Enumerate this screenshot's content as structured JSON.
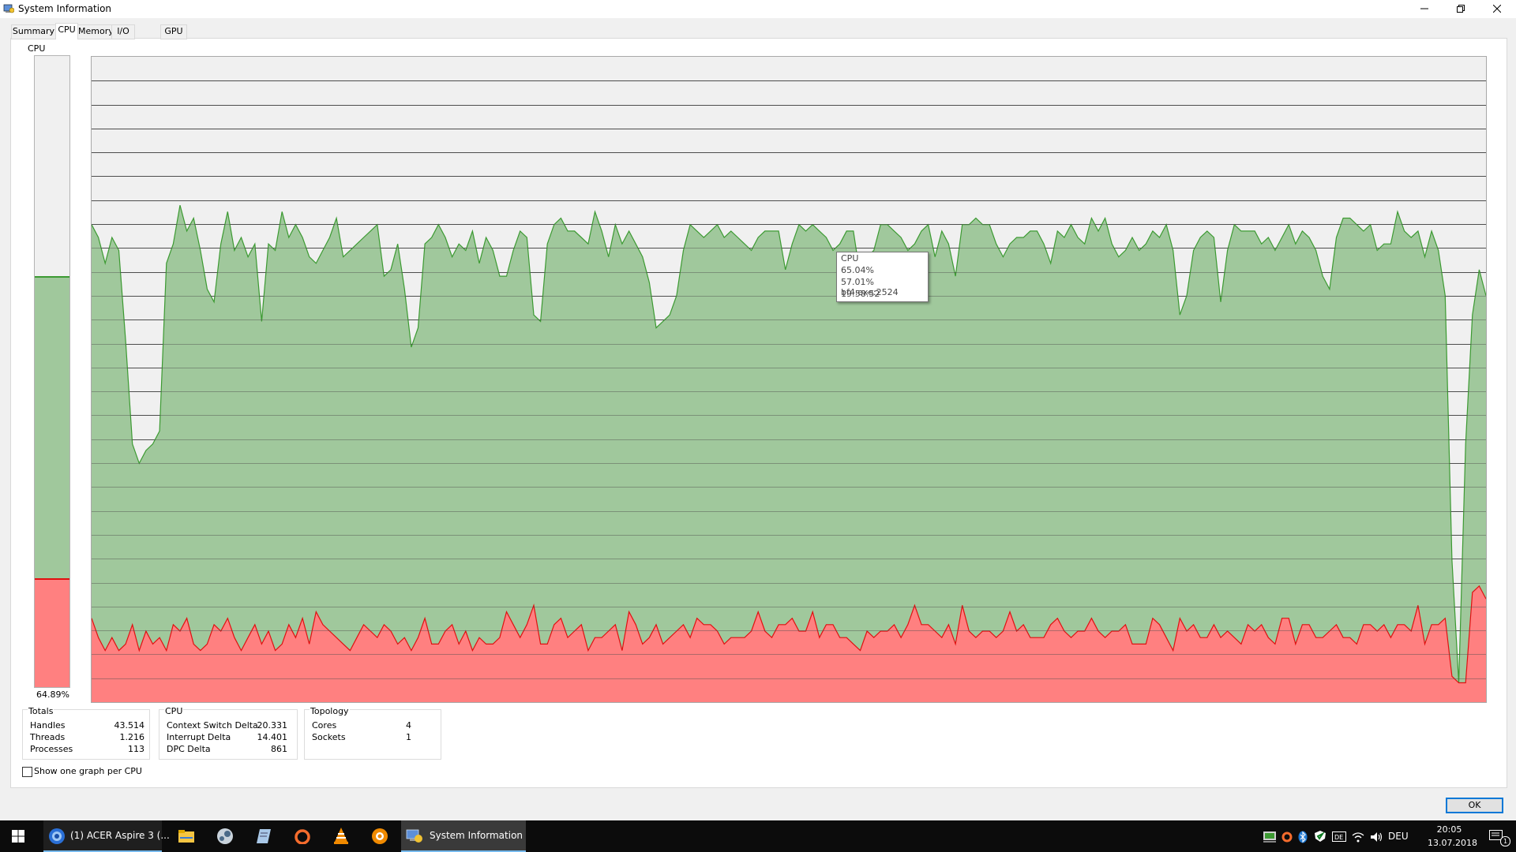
{
  "window": {
    "title": "System Information",
    "minimize_icon": "minimize-icon",
    "maximize_icon": "restore-icon",
    "close_icon": "close-icon"
  },
  "tabs": [
    {
      "label": "Summary",
      "active": false
    },
    {
      "label": "CPU",
      "active": true
    },
    {
      "label": "Memory",
      "active": false
    },
    {
      "label": "I/O",
      "active": false
    },
    {
      "label": "GPU",
      "active": false
    }
  ],
  "cpu_bar": {
    "label": "CPU",
    "percent_text": "64.89%",
    "total_fraction": 0.6489,
    "kernel_fraction": 0.17
  },
  "graph": {
    "colors": {
      "total": "#a0c89c",
      "total_line": "#3c9a32",
      "kernel": "#ff8080",
      "kernel_line": "#e01010",
      "background": "#f0f0f0",
      "grid": "#4d4d4d"
    },
    "tooltip": {
      "line1": "CPU",
      "line2": "65.04%",
      "line3": "57.01% bf4.exe:2524",
      "line4": "19:58:52"
    }
  },
  "chart_data": {
    "type": "area",
    "ylim": [
      0,
      100
    ],
    "grid": true,
    "series": [
      {
        "name": "Total CPU",
        "values": [
          74,
          72,
          68,
          72,
          70,
          56,
          40,
          37,
          39,
          40,
          42,
          68,
          71,
          77,
          73,
          75,
          70,
          64,
          62,
          71,
          76,
          70,
          72,
          69,
          71,
          59,
          71,
          70,
          76,
          72,
          74,
          72,
          69,
          68,
          70,
          72,
          75,
          69,
          70,
          71,
          72,
          73,
          74,
          66,
          67,
          71,
          64,
          55,
          58,
          71,
          72,
          74,
          72,
          69,
          71,
          70,
          73,
          68,
          72,
          70,
          66,
          66,
          70,
          73,
          72,
          60,
          59,
          71,
          74,
          75,
          73,
          73,
          72,
          71,
          76,
          73,
          69,
          74,
          71,
          73,
          71,
          69,
          65,
          58,
          59,
          60,
          63,
          70,
          74,
          73,
          72,
          73,
          74,
          72,
          73,
          72,
          71,
          70,
          72,
          73,
          73,
          73,
          67,
          71,
          74,
          73,
          74,
          73,
          72,
          70,
          71,
          73,
          73,
          66,
          69,
          70,
          74,
          74,
          73,
          72,
          70,
          71,
          73,
          74,
          69,
          73,
          71,
          66,
          74,
          74,
          75,
          74,
          74,
          71,
          69,
          71,
          72,
          72,
          73,
          73,
          71,
          68,
          73,
          72,
          74,
          72,
          71,
          75,
          73,
          75,
          71,
          69,
          70,
          72,
          70,
          71,
          73,
          72,
          74,
          70,
          60,
          63,
          70,
          72,
          73,
          72,
          62,
          70,
          74,
          73,
          73,
          73,
          71,
          72,
          70,
          72,
          74,
          71,
          73,
          72,
          70,
          66,
          64,
          72,
          75,
          75,
          74,
          73,
          74,
          70,
          71,
          71,
          76,
          73,
          72,
          73,
          69,
          73,
          70,
          63,
          22,
          3,
          40,
          60,
          67,
          63
        ]
      },
      {
        "name": "Kernel CPU",
        "values": [
          13,
          10,
          8,
          10,
          8,
          9,
          12,
          8,
          11,
          9,
          10,
          8,
          12,
          11,
          13,
          9,
          8,
          9,
          12,
          11,
          13,
          10,
          8,
          10,
          12,
          9,
          11,
          8,
          9,
          12,
          10,
          13,
          9,
          14,
          12,
          11,
          10,
          9,
          8,
          10,
          12,
          11,
          10,
          12,
          11,
          9,
          10,
          8,
          10,
          13,
          9,
          9,
          11,
          12,
          9,
          11,
          8,
          10,
          9,
          9,
          10,
          14,
          12,
          10,
          12,
          15,
          9,
          9,
          12,
          13,
          10,
          11,
          12,
          8,
          10,
          10,
          11,
          12,
          8,
          14,
          12,
          9,
          10,
          12,
          9,
          10,
          11,
          12,
          10,
          13,
          12,
          12,
          11,
          9,
          10,
          10,
          10,
          11,
          14,
          11,
          10,
          12,
          12,
          13,
          11,
          11,
          14,
          10,
          12,
          12,
          10,
          10,
          9,
          8,
          11,
          10,
          11,
          11,
          12,
          10,
          12,
          15,
          12,
          12,
          11,
          10,
          12,
          9,
          15,
          11,
          10,
          11,
          11,
          10,
          11,
          14,
          11,
          12,
          10,
          10,
          10,
          12,
          13,
          11,
          10,
          11,
          11,
          13,
          11,
          10,
          11,
          11,
          12,
          9,
          9,
          9,
          13,
          12,
          10,
          8,
          13,
          11,
          12,
          10,
          10,
          12,
          10,
          11,
          10,
          9,
          12,
          11,
          12,
          10,
          9,
          13,
          13,
          9,
          12,
          12,
          10,
          10,
          11,
          12,
          10,
          10,
          9,
          12,
          12,
          11,
          12,
          10,
          12,
          12,
          11,
          15,
          9,
          12,
          12,
          13,
          4,
          3,
          3,
          17,
          18,
          16
        ]
      }
    ]
  },
  "totals": {
    "title": "Totals",
    "rows": [
      {
        "label": "Handles",
        "value": "43.514"
      },
      {
        "label": "Threads",
        "value": "1.216"
      },
      {
        "label": "Processes",
        "value": "113"
      }
    ]
  },
  "cpu_stats": {
    "title": "CPU",
    "rows": [
      {
        "label": "Context Switch Delta",
        "value": "20.331"
      },
      {
        "label": "Interrupt Delta",
        "value": "14.401"
      },
      {
        "label": "DPC Delta",
        "value": "861"
      }
    ]
  },
  "topology": {
    "title": "Topology",
    "rows": [
      {
        "label": "Cores",
        "value": "4"
      },
      {
        "label": "Sockets",
        "value": "1"
      }
    ]
  },
  "options": {
    "show_one_graph_label": "Show one graph per CPU",
    "show_one_graph_checked": false
  },
  "buttons": {
    "ok_label": "OK"
  },
  "taskbar": {
    "items": [
      {
        "icon": "chrome-icon",
        "label": "(1) ACER Aspire 3 (..."
      },
      {
        "icon": "file-explorer-icon",
        "label": ""
      },
      {
        "icon": "steam-icon",
        "label": ""
      },
      {
        "icon": "notepad-icon",
        "label": ""
      },
      {
        "icon": "origin-icon",
        "label": ""
      },
      {
        "icon": "vlc-icon",
        "label": ""
      },
      {
        "icon": "xnview-icon",
        "label": ""
      },
      {
        "icon": "system-information-icon",
        "label": "System Information"
      }
    ],
    "language": "DEU",
    "time": "20:05",
    "date": "13.07.2018",
    "notification_count": "1"
  }
}
